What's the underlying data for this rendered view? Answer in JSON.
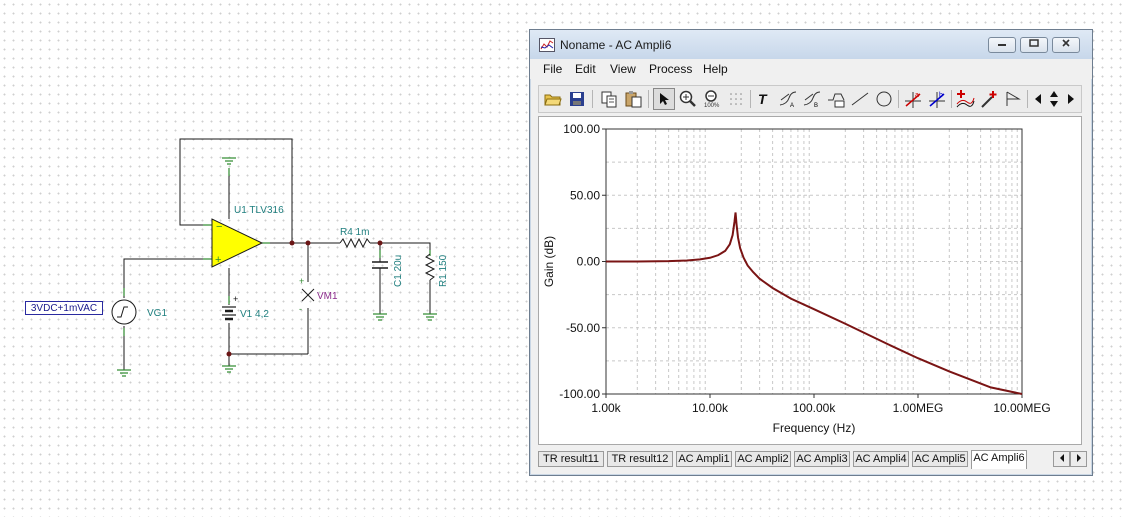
{
  "schematic": {
    "source_value": "3VDC+1mVAC",
    "source_name": "VG1",
    "opamp_label": "U1 TLV316",
    "battery_label": "V1 4,2",
    "voltmeter_label": "VM1",
    "resistor_r4": "R4 1m",
    "capacitor_c1": "C1 20u",
    "resistor_r1": "R1 150",
    "plus_sign": "+",
    "minus_sign": "-"
  },
  "window": {
    "title": "Noname - AC Ampli6",
    "menu": [
      "File",
      "Edit",
      "View",
      "Process",
      "Help"
    ],
    "toolbar_icons": [
      "open-folder-icon",
      "save-icon",
      "copy-icon",
      "paste-icon",
      "pointer-icon",
      "zoom-in-icon",
      "zoom-out-icon",
      "grid-icon",
      "text-icon",
      "curve-label-icon",
      "curve-label2-icon",
      "curve-label3-icon",
      "line-icon",
      "circle-icon",
      "cursor-a-icon",
      "cursor-b-icon",
      "add-curve-icon",
      "color-pick-icon",
      "marker-icon",
      "arrow-left-icon",
      "arrow-updown-icon",
      "arrow-right-icon"
    ],
    "tabs": [
      "TR result11",
      "TR result12",
      "AC Ampli1",
      "AC Ampli2",
      "AC Ampli3",
      "AC Ampli4",
      "AC Ampli5",
      "AC Ampli6"
    ],
    "active_tab": "AC Ampli6"
  },
  "chart_data": {
    "type": "line",
    "title": "",
    "xlabel": "Frequency (Hz)",
    "ylabel": "Gain (dB)",
    "x_scale": "log",
    "xlim": [
      1000,
      10000000
    ],
    "ylim": [
      -100,
      100
    ],
    "x_ticks": [
      "1.00k",
      "10.00k",
      "100.00k",
      "1.00MEG",
      "10.00MEG"
    ],
    "y_ticks": [
      "100.00",
      "50.00",
      "0.00",
      "-50.00",
      "-100.00"
    ],
    "grid": true,
    "line_color": "#7a1414",
    "series": [
      {
        "x": [
          1000,
          2000,
          4000,
          6000,
          8000,
          10000,
          12000,
          14000,
          15500,
          16500,
          17200,
          17600,
          18000,
          18600,
          19500,
          21000,
          23000,
          26000,
          30000,
          40000,
          60000,
          100000,
          200000,
          500000,
          1000000,
          2000000,
          5000000,
          10000000
        ],
        "y": [
          0,
          0,
          0.3,
          0.8,
          1.6,
          2.8,
          4.8,
          8,
          13,
          20,
          30,
          37,
          28,
          18,
          10,
          3,
          -3,
          -8,
          -13,
          -20,
          -28,
          -36,
          -47,
          -62,
          -73,
          -83,
          -95,
          -100
        ]
      }
    ]
  }
}
